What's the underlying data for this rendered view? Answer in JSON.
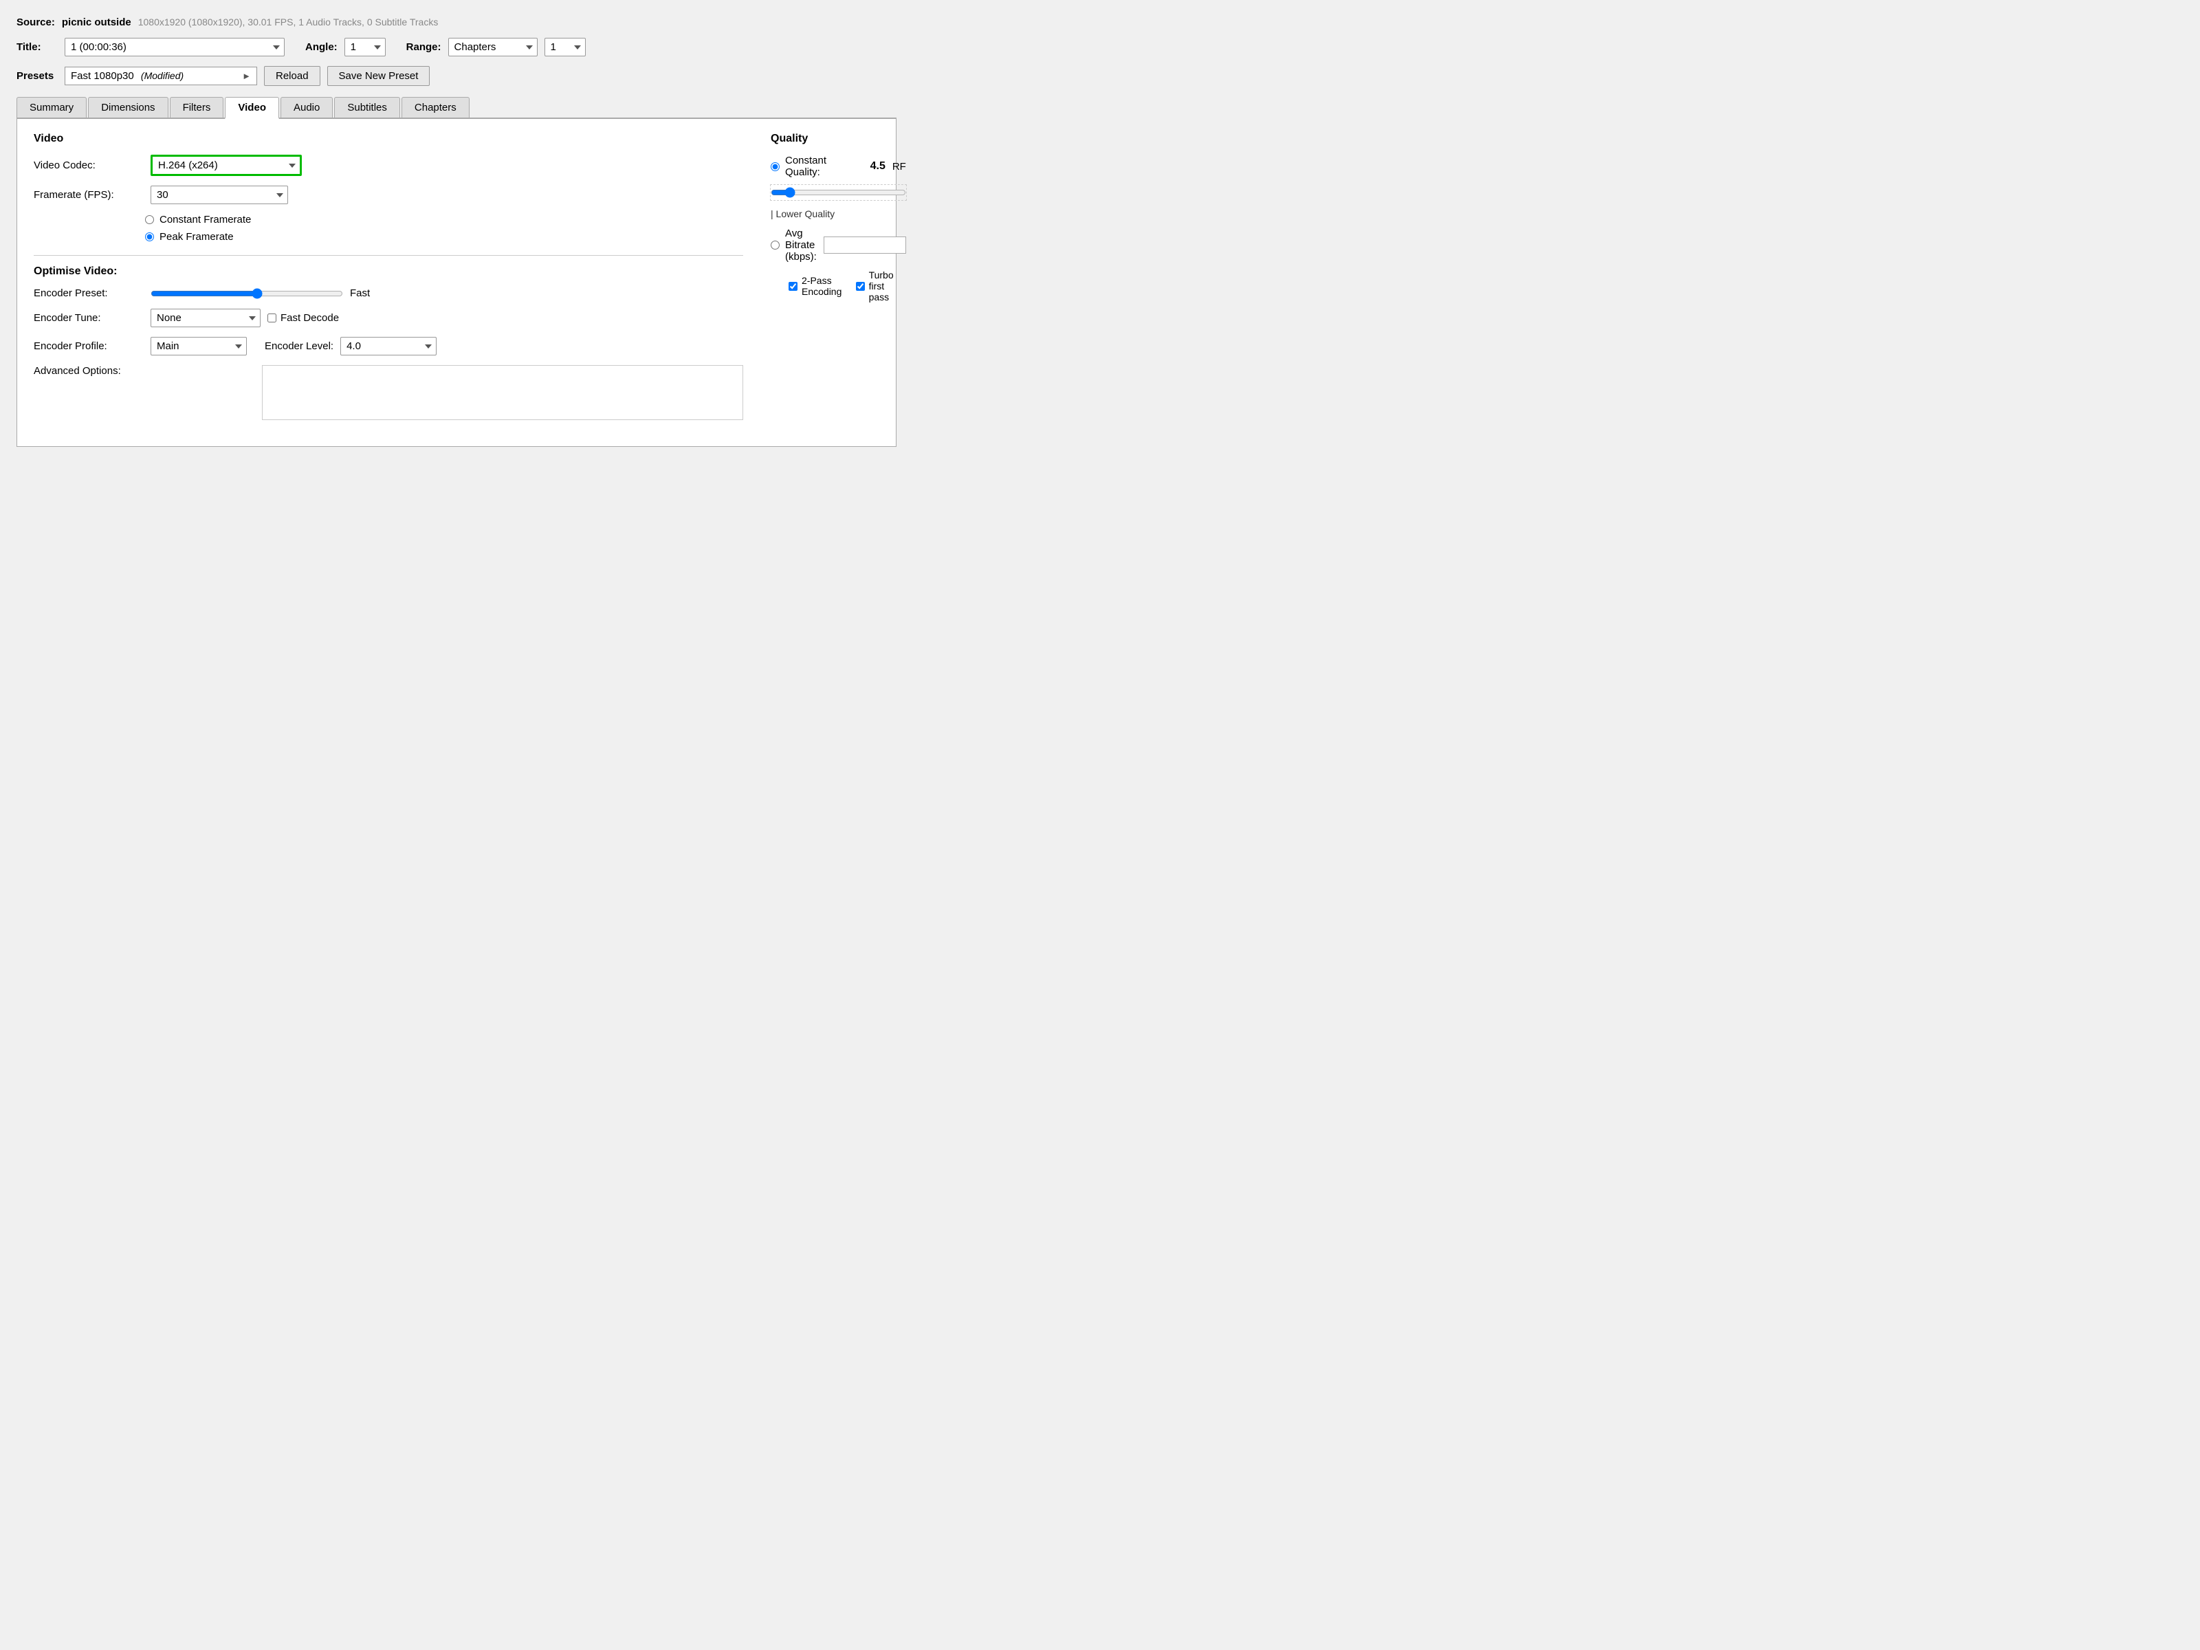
{
  "source": {
    "label": "Source:",
    "filename": "picnic outside",
    "details": "1080x1920 (1080x1920), 30.01 FPS, 1 Audio Tracks, 0 Subtitle Tracks"
  },
  "title_row": {
    "label": "Title:",
    "title_value": "1 (00:00:36)",
    "angle_label": "Angle:",
    "angle_value": "1",
    "range_label": "Range:",
    "range_value": "Chapters",
    "range_num_value": "1"
  },
  "presets": {
    "label": "Presets",
    "preset_name": "Fast 1080p30",
    "preset_modified": "(Modified)",
    "reload_label": "Reload",
    "save_new_label": "Save New Preset"
  },
  "tabs": {
    "items": [
      {
        "label": "Summary",
        "active": false
      },
      {
        "label": "Dimensions",
        "active": false
      },
      {
        "label": "Filters",
        "active": false
      },
      {
        "label": "Video",
        "active": true
      },
      {
        "label": "Audio",
        "active": false
      },
      {
        "label": "Subtitles",
        "active": false
      },
      {
        "label": "Chapters",
        "active": false
      }
    ]
  },
  "video_section": {
    "title": "Video",
    "codec_label": "Video Codec:",
    "codec_value": "H.264 (x264)",
    "fps_label": "Framerate (FPS):",
    "fps_value": "30",
    "constant_framerate_label": "Constant Framerate",
    "peak_framerate_label": "Peak Framerate",
    "peak_framerate_selected": true,
    "constant_framerate_selected": false
  },
  "quality_section": {
    "title": "Quality",
    "constant_quality_label": "Constant Quality:",
    "constant_quality_value": "4.5",
    "rf_label": "RF",
    "lower_quality_label": "| Lower Quality",
    "avg_bitrate_label": "Avg Bitrate (kbps):",
    "avg_bitrate_value": "",
    "two_pass_label": "2-Pass Encoding",
    "two_pass_checked": true,
    "turbo_label": "Turbo first pass",
    "turbo_checked": true,
    "constant_quality_selected": true,
    "avg_bitrate_selected": false
  },
  "optimise_section": {
    "title": "Optimise Video:",
    "encoder_preset_label": "Encoder Preset:",
    "encoder_preset_value": "Fast",
    "encoder_tune_label": "Encoder Tune:",
    "encoder_tune_value": "None",
    "fast_decode_label": "Fast Decode",
    "fast_decode_checked": false,
    "encoder_profile_label": "Encoder Profile:",
    "encoder_profile_value": "Main",
    "encoder_level_label": "Encoder Level:",
    "encoder_level_value": "4.0",
    "advanced_options_label": "Advanced Options:"
  }
}
